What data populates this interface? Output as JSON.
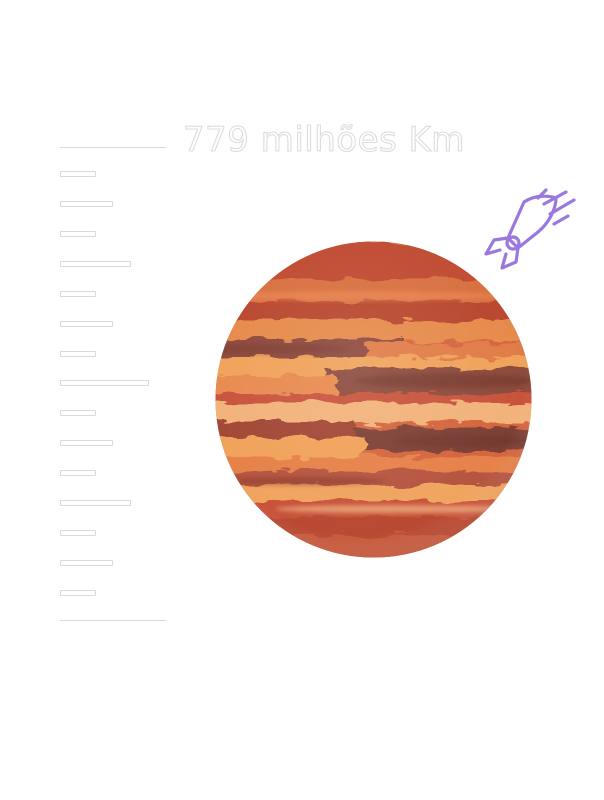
{
  "distance": {
    "label": "779 milhões Km"
  },
  "ruler": {
    "major_tick_count": 2,
    "minor_tick_count": 15
  },
  "planet": {
    "name_icon": "planet-illustration",
    "palette": [
      "#c8533a",
      "#e07b46",
      "#f0a25a",
      "#8e4a3c",
      "#b8462f",
      "#f2b27a"
    ]
  },
  "rocket": {
    "icon": "rocket-icon",
    "color": "#9b77e0"
  }
}
